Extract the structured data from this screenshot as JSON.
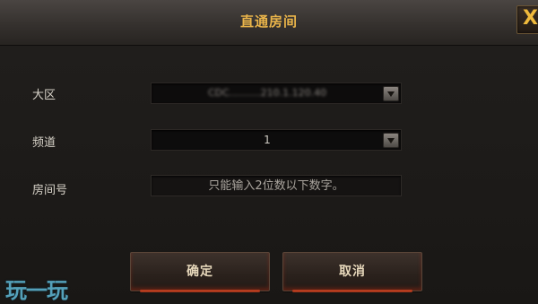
{
  "dialog": {
    "title": "直通房间",
    "close_glyph": "X"
  },
  "form": {
    "region": {
      "label": "大区",
      "value": "CDC..........210.1.120.40"
    },
    "channel": {
      "label": "频道",
      "value": "1"
    },
    "room": {
      "label": "房间号",
      "placeholder": "只能输入2位数以下数字。",
      "value": ""
    }
  },
  "buttons": {
    "confirm_label": "确定",
    "cancel_label": "取消"
  },
  "watermark": {
    "text": "玩一玩"
  },
  "colors": {
    "title": "#e9b44a",
    "close_icon": "#f0ba3c",
    "accent_glow": "#d6401d"
  }
}
